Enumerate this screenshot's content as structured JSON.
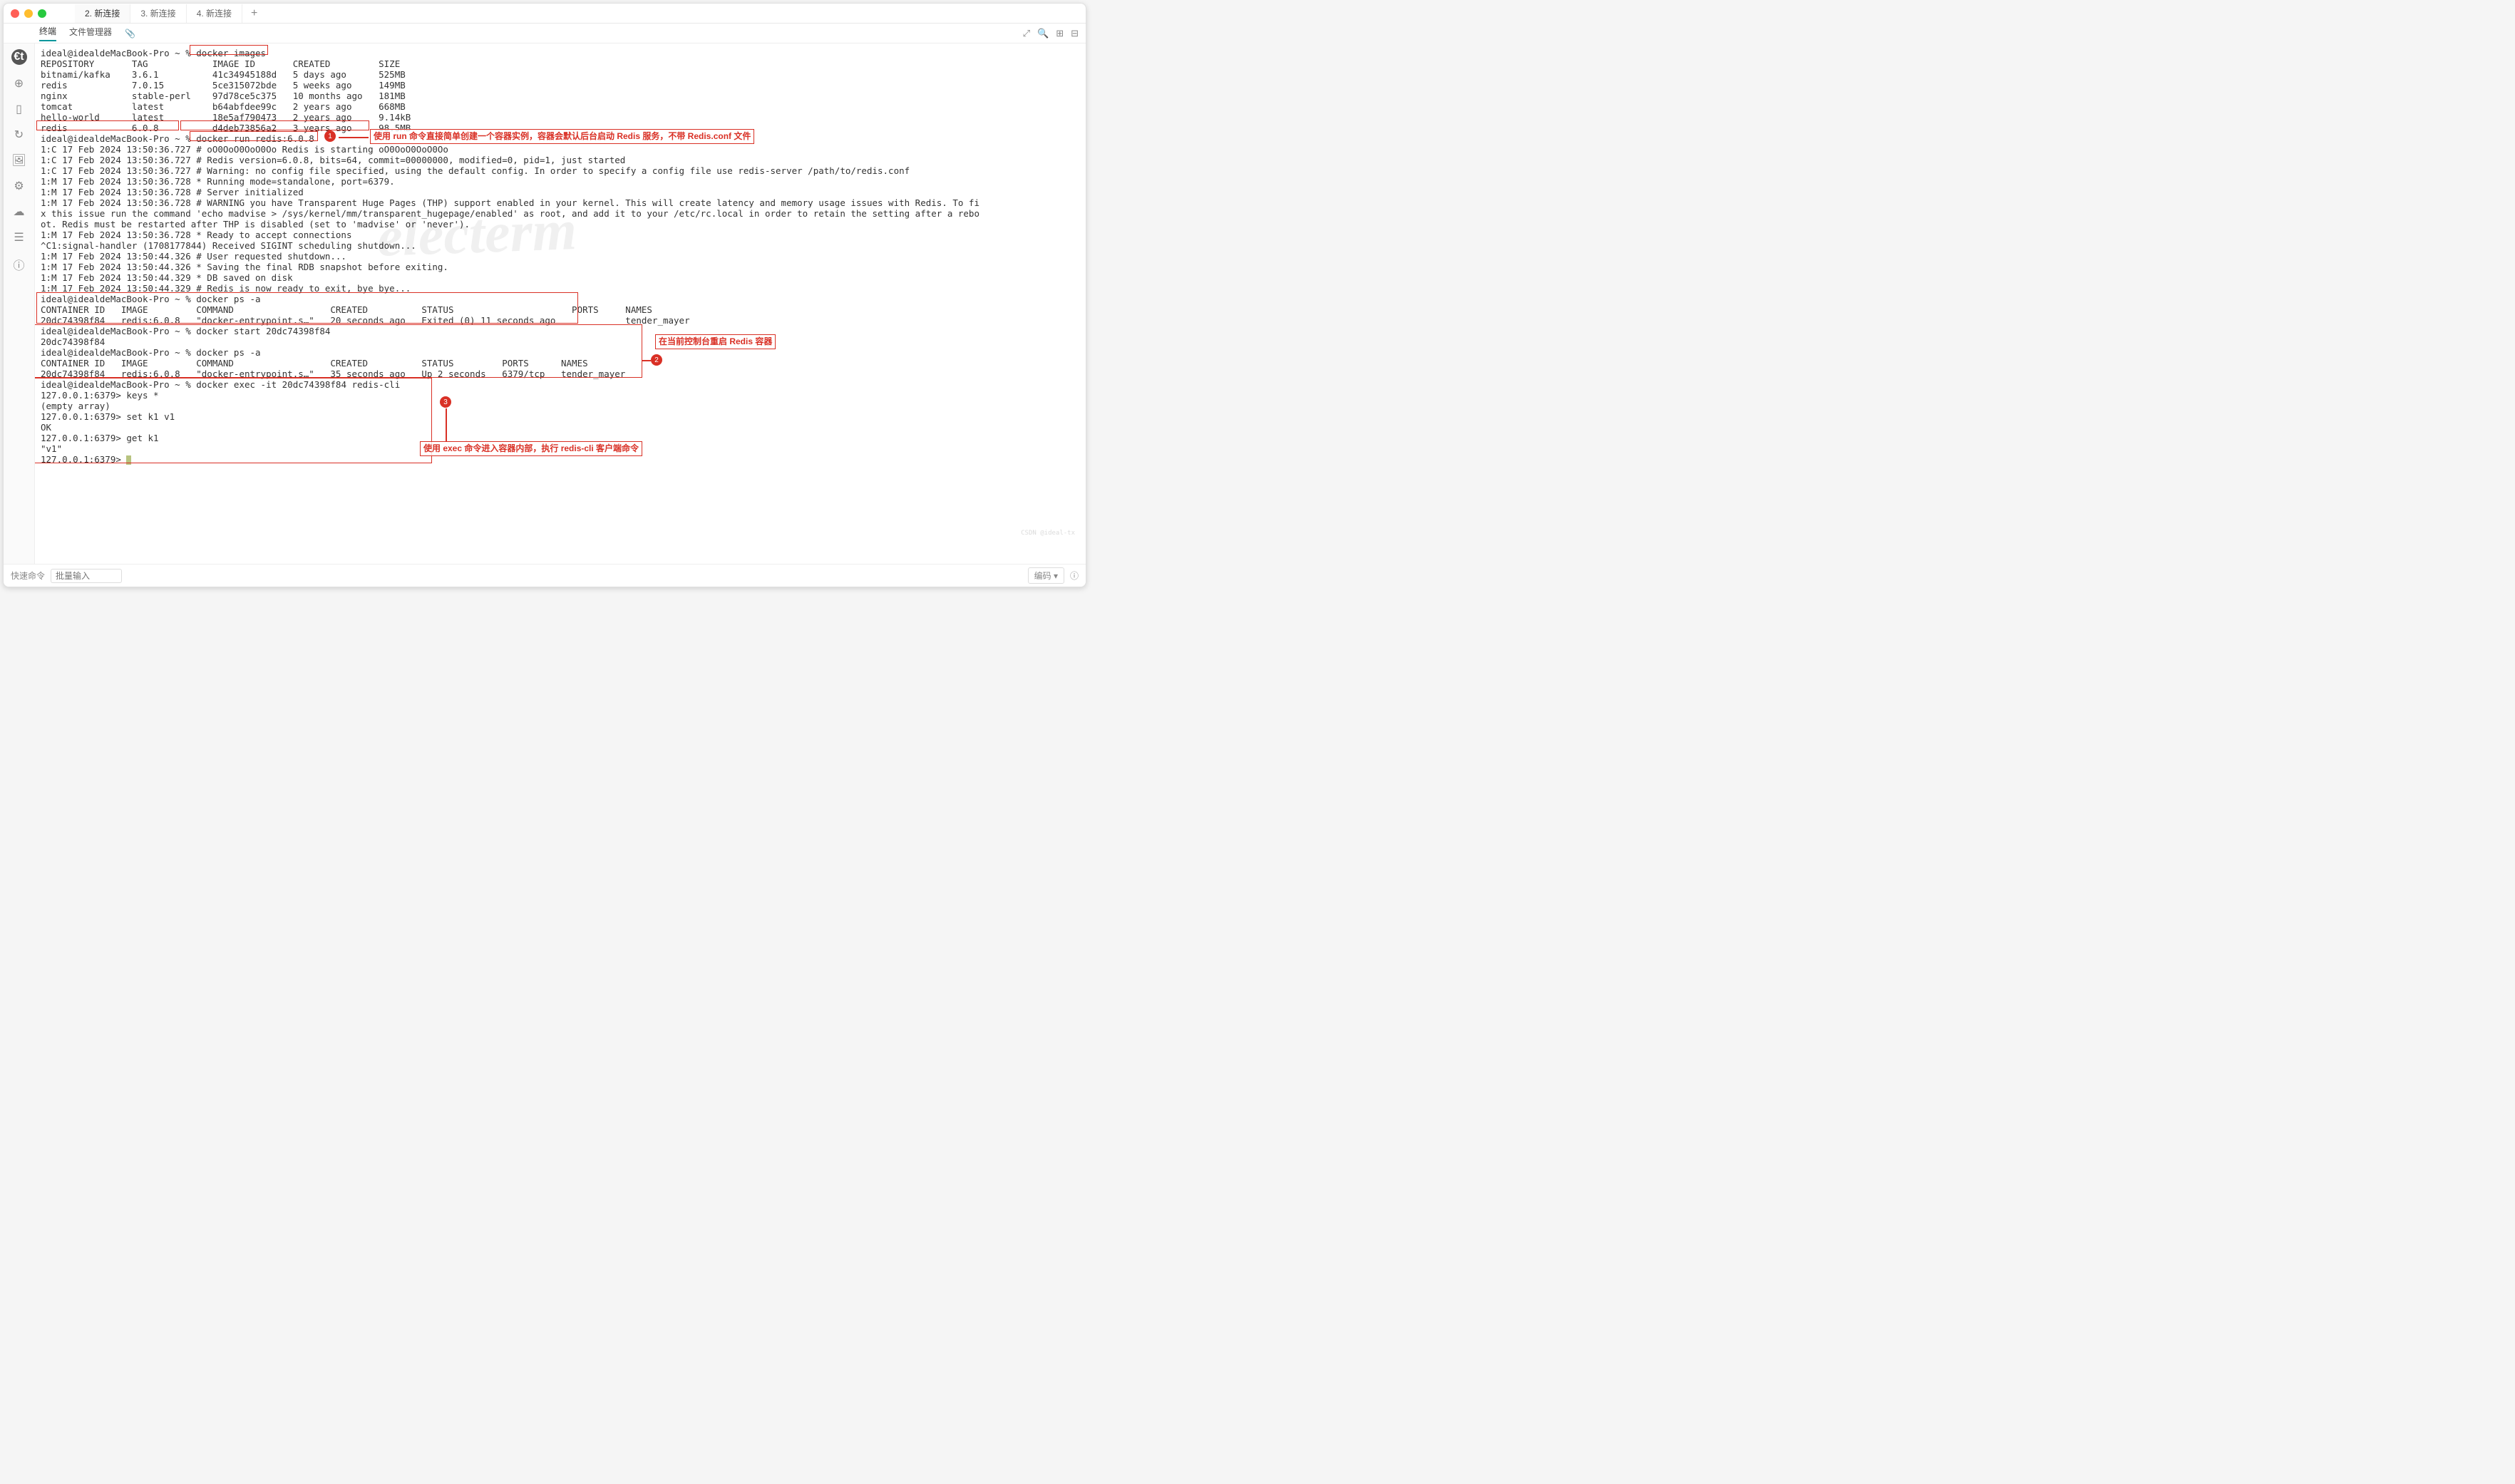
{
  "tabs": [
    "2. 新连接",
    "3. 新连接",
    "4. 新连接"
  ],
  "subtabs": {
    "terminal": "终端",
    "fileManager": "文件管理器"
  },
  "sidebar": {
    "logo": "€t"
  },
  "rightIcons": [
    "⤢",
    "🔍",
    "⊞",
    "⊟"
  ],
  "footer": {
    "quick": "快速命令",
    "batchPlaceholder": "批量输入",
    "encoding": "编码",
    "info": "ⓘ"
  },
  "annotations": {
    "a1": "使用 run 命令直接简单创建一个容器实例，容器会默认后台启动 Redis 服务，不带 Redis.conf 文件",
    "a2": "在当前控制台重启 Redis 容器",
    "a3": "使用 exec 命令进入容器内部，执行 redis-cli 客户端命令"
  },
  "watermark": "electerm",
  "watermark2": "CSDN @ideal-tx",
  "terminal": {
    "prompt1": "ideal@idealdeMacBook-Pro ~ % ",
    "cmd_images": "docker images",
    "images_header": "REPOSITORY       TAG            IMAGE ID       CREATED         SIZE",
    "images_rows": [
      "bitnami/kafka    3.6.1          41c34945188d   5 days ago      525MB",
      "redis            7.0.15         5ce315072bde   5 weeks ago     149MB",
      "nginx            stable-perl    97d78ce5c375   10 months ago   181MB",
      "tomcat           latest         b64abfdee99c   2 years ago     668MB",
      "hello-world      latest         18e5af790473   2 years ago     9.14kB",
      "redis            6.0.8          d4deb73856a2   3 years ago     98.5MB"
    ],
    "cmd_run": "docker run redis:6.0.8",
    "run_output": [
      "1:C 17 Feb 2024 13:50:36.727 # oO0OoO0OoO0Oo Redis is starting oO0OoO0OoO0Oo",
      "1:C 17 Feb 2024 13:50:36.727 # Redis version=6.0.8, bits=64, commit=00000000, modified=0, pid=1, just started",
      "1:C 17 Feb 2024 13:50:36.727 # Warning: no config file specified, using the default config. In order to specify a config file use redis-server /path/to/redis.conf",
      "1:M 17 Feb 2024 13:50:36.728 * Running mode=standalone, port=6379.",
      "1:M 17 Feb 2024 13:50:36.728 # Server initialized",
      "1:M 17 Feb 2024 13:50:36.728 # WARNING you have Transparent Huge Pages (THP) support enabled in your kernel. This will create latency and memory usage issues with Redis. To fi",
      "x this issue run the command 'echo madvise > /sys/kernel/mm/transparent_hugepage/enabled' as root, and add it to your /etc/rc.local in order to retain the setting after a rebo",
      "ot. Redis must be restarted after THP is disabled (set to 'madvise' or 'never').",
      "1:M 17 Feb 2024 13:50:36.728 * Ready to accept connections",
      "^C1:signal-handler (1708177844) Received SIGINT scheduling shutdown...",
      "1:M 17 Feb 2024 13:50:44.326 # User requested shutdown...",
      "1:M 17 Feb 2024 13:50:44.326 * Saving the final RDB snapshot before exiting.",
      "1:M 17 Feb 2024 13:50:44.329 * DB saved on disk",
      "1:M 17 Feb 2024 13:50:44.329 # Redis is now ready to exit, bye bye..."
    ],
    "cmd_psa1": "docker ps -a",
    "psa1_header": "CONTAINER ID   IMAGE         COMMAND                  CREATED          STATUS                      PORTS     NAMES",
    "psa1_row": "20dc74398f84   redis:6.0.8   \"docker-entrypoint.s…\"   20 seconds ago   Exited (0) 11 seconds ago             tender_mayer",
    "cmd_start": "docker start 20dc74398f84",
    "start_out": "20dc74398f84",
    "cmd_psa2": "docker ps -a",
    "psa2_header": "CONTAINER ID   IMAGE         COMMAND                  CREATED          STATUS         PORTS      NAMES",
    "psa2_row": "20dc74398f84   redis:6.0.8   \"docker-entrypoint.s…\"   35 seconds ago   Up 2 seconds   6379/tcp   tender_mayer",
    "cmd_exec": "docker exec -it 20dc74398f84 redis-cli",
    "cli": [
      "127.0.0.1:6379> keys *",
      "(empty array)",
      "127.0.0.1:6379> set k1 v1",
      "OK",
      "127.0.0.1:6379> get k1",
      "\"v1\"",
      "127.0.0.1:6379> "
    ]
  }
}
